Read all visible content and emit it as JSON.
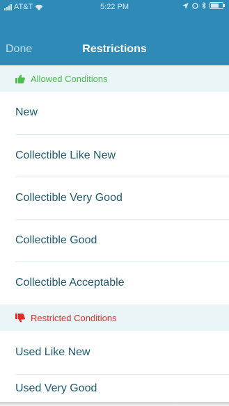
{
  "status_bar": {
    "carrier": "AT&T",
    "time": "5:22 PM"
  },
  "nav": {
    "done_label": "Done",
    "title": "Restrictions"
  },
  "sections": {
    "allowed": {
      "label": "Allowed Conditions",
      "icon": "thumbs-up-icon",
      "color": "#4bbe4b",
      "items": [
        "New",
        "Collectible Like New",
        "Collectible Very Good",
        "Collectible Good",
        "Collectible Acceptable"
      ]
    },
    "restricted": {
      "label": "Restricted Conditions",
      "icon": "thumbs-down-icon",
      "color": "#e8292c",
      "items": [
        "Used Like New",
        "Used Very Good"
      ]
    }
  },
  "colors": {
    "nav_background": "#2e8bb8",
    "section_background": "#e9f5f7",
    "row_text": "#1f5a6e"
  }
}
